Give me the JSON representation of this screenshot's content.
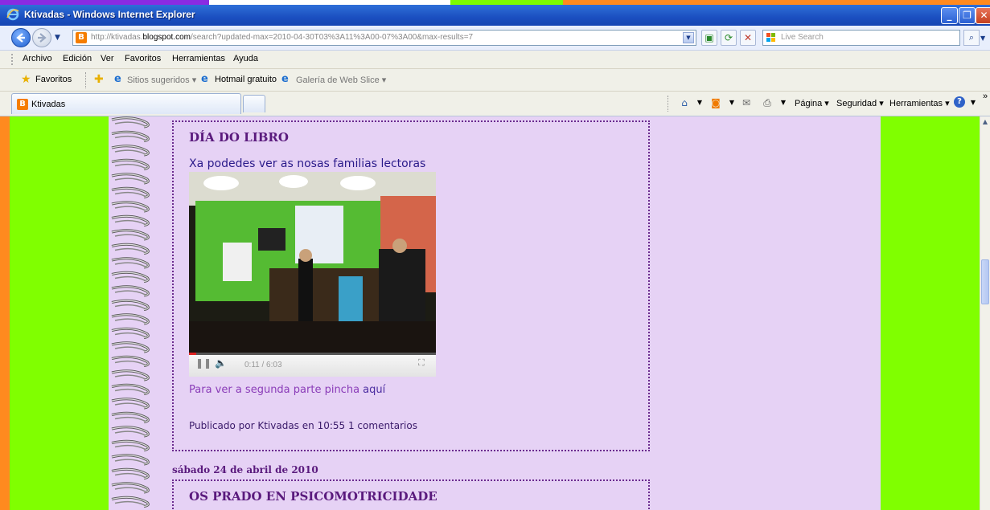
{
  "window": {
    "title": "Ktivadas - Windows Internet Explorer",
    "buttons": {
      "minimize": "_",
      "maximize": "❐",
      "close": "✕"
    }
  },
  "addressbar": {
    "url_prefix": "http://ktivadas.",
    "url_host": "blogspot.com",
    "url_path": "/search?updated-max=2010-04-30T03%3A11%3A00-07%3A00&max-results=7",
    "search_placeholder": "Live Search"
  },
  "menu": {
    "items": [
      {
        "label": "Archivo"
      },
      {
        "label": "Edición"
      },
      {
        "label": "Ver"
      },
      {
        "label": "Favoritos"
      },
      {
        "label": "Herramientas"
      },
      {
        "label": "Ayuda"
      }
    ]
  },
  "favorites_bar": {
    "favorites_label": "Favoritos",
    "items": [
      {
        "label": "Sitios sugeridos ▾"
      },
      {
        "label": "Hotmail gratuito"
      },
      {
        "label": "Galería de Web Slice ▾"
      }
    ]
  },
  "tabs": {
    "active_label": "Ktivadas"
  },
  "command_bar": {
    "page": "Página ▾",
    "security": "Seguridad ▾",
    "tools": "Herramientas ▾",
    "more": "»"
  },
  "blog": {
    "post1": {
      "title": "DÍA DO LIBRO",
      "text": "Xa podedes ver as nosas familias lectoras",
      "video": {
        "time": "0:11 / 6:03",
        "progress": 0.03
      },
      "link_text": "Para ver a segunda parte pincha ",
      "link_anchor": "aquí",
      "footer_prefix": "Publicado por Ktivadas en ",
      "footer_time": "10:55",
      "footer_comments": "1 comentarios"
    },
    "date_header": "sábado 24 de abril de 2010",
    "post2": {
      "title": "OS PRADO EN PSICOMOTRICIDADE"
    }
  },
  "colors": {
    "outer_background": "#80ff00",
    "page_background": "#e6d2f5",
    "title_color": "#5a1a7d",
    "border_color": "#6b2b8f"
  }
}
